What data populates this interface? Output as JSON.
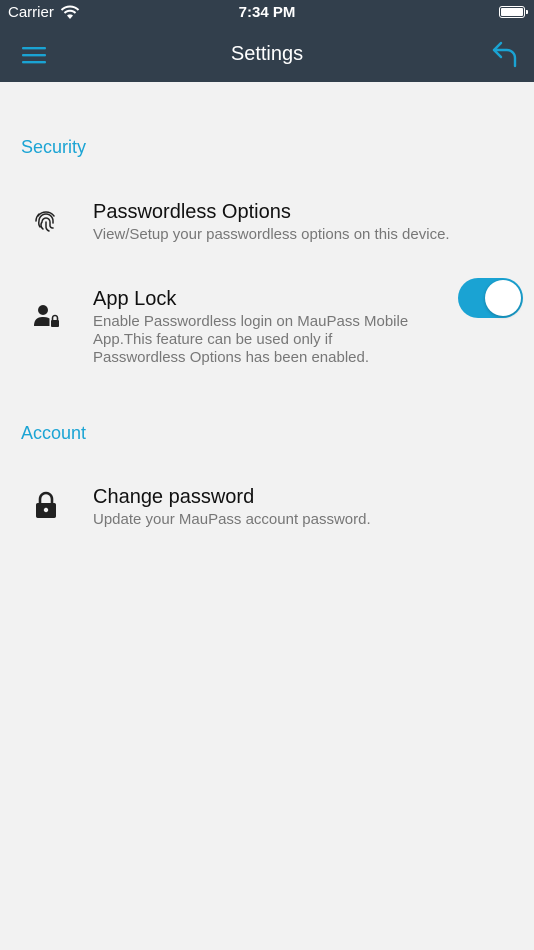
{
  "status_bar": {
    "carrier": "Carrier",
    "time": "7:34 PM",
    "wifi_icon": "wifi-icon",
    "battery_icon": "battery-icon"
  },
  "nav": {
    "title": "Settings",
    "menu_icon": "hamburger-menu-icon",
    "back_icon": "undo-arrow-icon"
  },
  "colors": {
    "header_bg": "#323f4c",
    "accent": "#1aa3d3",
    "page_bg": "#f2f2f2",
    "title_text": "#111111",
    "desc_text": "#777777"
  },
  "sections": [
    {
      "header": "Security",
      "items": [
        {
          "icon": "fingerprint-icon",
          "title": "Passwordless Options",
          "description": "View/Setup your passwordless options on this device."
        },
        {
          "icon": "user-lock-icon",
          "title": "App Lock",
          "description_lines": [
            "Enable Passwordless login on MauPass Mobile",
            "App.This feature can be used only if",
            "Passwordless Options has been enabled."
          ],
          "toggle_on": true
        }
      ]
    },
    {
      "header": "Account",
      "items": [
        {
          "icon": "lock-icon",
          "title": "Change password",
          "description": "Update your MauPass account password."
        }
      ]
    }
  ]
}
